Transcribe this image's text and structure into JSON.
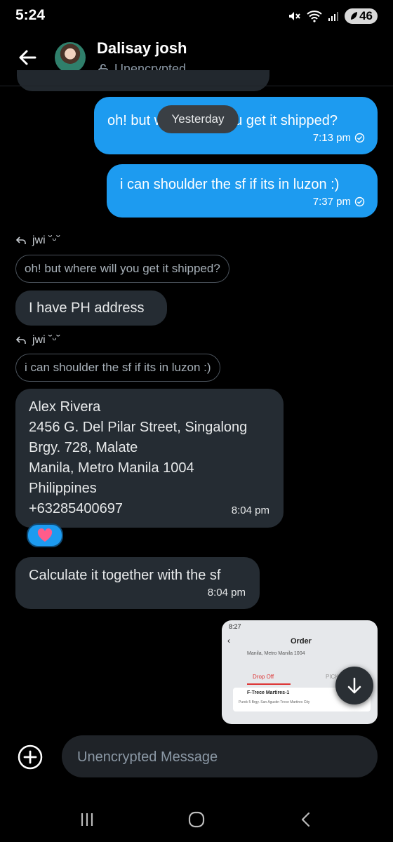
{
  "status_bar": {
    "time": "5:24",
    "battery": "46"
  },
  "header": {
    "name": "Dalisay josh",
    "encryption": "Unencrypted"
  },
  "date_divider": "Yesterday",
  "messages": {
    "out1": {
      "text": "oh! but where will you get it shipped?",
      "time": "7:13 pm"
    },
    "out2": {
      "text": "i can shoulder the sf if its in luzon :)",
      "time": "7:37 pm"
    },
    "reply1": {
      "user": "jwi ˘ᵕ˘",
      "quote": "oh! but where will you get it shipped?"
    },
    "in1": {
      "text": "I have PH address"
    },
    "reply2": {
      "user": "jwi ˘ᵕ˘",
      "quote": "i can shoulder the sf if its in luzon :)"
    },
    "in2": {
      "lines": [
        "Alex Rivera",
        "2456 G. Del Pilar Street, Singalong",
        "Brgy. 728, Malate",
        "Manila, Metro Manila 1004",
        "Philippines",
        "+63285400697"
      ],
      "time": "8:04 pm",
      "reaction": "heart-emoji"
    },
    "in3": {
      "text": "Calculate it together with the sf",
      "time": "8:04 pm"
    }
  },
  "image_preview": {
    "time": "8:27",
    "title": "Order",
    "address": "Manila, Metro Manila 1004",
    "tab_drop": "Drop Off",
    "tab_pick": "PICK",
    "store": "F-Trece Martires-1",
    "store_addr": "Purok 5 Brgy. San Agustin Trece Martires City"
  },
  "composer": {
    "placeholder": "Unencrypted Message"
  },
  "colors": {
    "outgoing_bubble": "#1d9bf0",
    "incoming_bubble": "#252c33",
    "background": "#000000"
  }
}
